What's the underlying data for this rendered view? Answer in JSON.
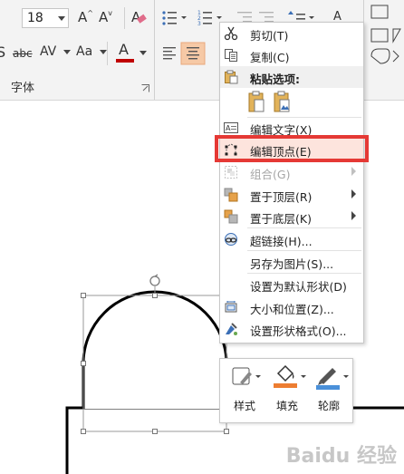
{
  "ribbon": {
    "font_size": "18",
    "font_group_label": "字体",
    "spacing_label": "AV",
    "case_label": "Aa",
    "strike_label": "abc",
    "font_color_label": "A",
    "grow_label": "A",
    "shrink_label": "A",
    "font_color": "#c00000"
  },
  "context_menu": {
    "items": [
      {
        "label": "剪切(T)",
        "icon": "scissors-icon"
      },
      {
        "label": "复制(C)",
        "icon": "copy-icon"
      },
      {
        "label": "粘贴选项:",
        "icon": "paste-icon"
      },
      {
        "label": "编辑文字(X)",
        "icon": "edit-text-icon"
      },
      {
        "label": "编辑顶点(E)",
        "icon": "edit-points-icon"
      },
      {
        "label": "组合(G)",
        "icon": "group-icon"
      },
      {
        "label": "置于顶层(R)",
        "icon": "bring-to-front-icon"
      },
      {
        "label": "置于底层(K)",
        "icon": "send-to-back-icon"
      },
      {
        "label": "超链接(H)...",
        "icon": "hyperlink-icon"
      },
      {
        "label": "另存为图片(S)...",
        "icon": ""
      },
      {
        "label": "设置为默认形状(D)",
        "icon": ""
      },
      {
        "label": "大小和位置(Z)...",
        "icon": "size-position-icon"
      },
      {
        "label": "设置形状格式(O)...",
        "icon": "format-shape-icon"
      }
    ],
    "highlight_color": "#e53935"
  },
  "mini_toolbar": {
    "style_label": "样式",
    "fill_label": "填充",
    "outline_label": "轮廓",
    "fill_color": "#ed7d31",
    "outline_color": "#4a90d9"
  },
  "watermark": "Baidu 经验"
}
